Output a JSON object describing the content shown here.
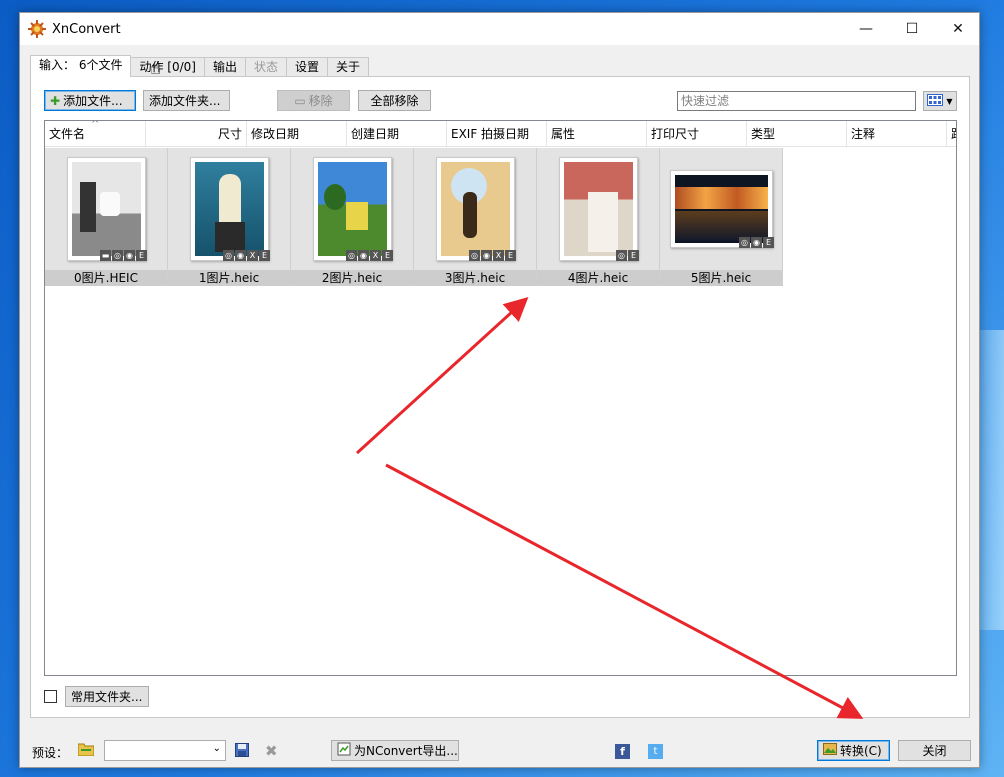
{
  "window": {
    "title": "XnConvert",
    "minimize": "—",
    "maximize": "☐",
    "close": "✕"
  },
  "tabs": [
    {
      "label": "输入： 6个文件",
      "state": "active"
    },
    {
      "label": "动作 [0/0]",
      "state": "normal"
    },
    {
      "label": "输出",
      "state": "normal"
    },
    {
      "label": "状态",
      "state": "disabled"
    },
    {
      "label": "设置",
      "state": "normal"
    },
    {
      "label": "关于",
      "state": "normal"
    }
  ],
  "toolbar": {
    "add_files": "添加文件...",
    "add_folder": "添加文件夹...",
    "remove": "移除",
    "remove_all": "全部移除",
    "filter_placeholder": "快速过滤"
  },
  "columns": [
    "文件名",
    "尺寸",
    "修改日期",
    "创建日期",
    "EXIF 拍摄日期",
    "属性",
    "打印尺寸",
    "类型",
    "注释",
    "跟"
  ],
  "files": [
    {
      "name": "0图片.HEIC",
      "badges": [
        "▬",
        "◎",
        "◉",
        "E"
      ],
      "orientation": "portrait"
    },
    {
      "name": "1图片.heic",
      "badges": [
        "◎",
        "◉",
        "X",
        "E"
      ],
      "orientation": "portrait"
    },
    {
      "name": "2图片.heic",
      "badges": [
        "◎",
        "◉",
        "X",
        "E"
      ],
      "orientation": "portrait"
    },
    {
      "name": "3图片.heic",
      "badges": [
        "◎",
        "◉",
        "X",
        "E"
      ],
      "orientation": "portrait"
    },
    {
      "name": "4图片.heic",
      "badges": [
        "◎",
        "E"
      ],
      "orientation": "portrait"
    },
    {
      "name": "5图片.heic",
      "badges": [
        "◎",
        "◉",
        "E"
      ],
      "orientation": "landscape"
    }
  ],
  "favorites_label": "常用文件夹...",
  "bottom": {
    "preset_label": "预设：",
    "export_label": "为NConvert导出...",
    "convert_label": "转换(C)",
    "close_label": "关闭"
  },
  "colors": {
    "annotation_arrow": "#e8262b",
    "selected_tab": "#ffffff",
    "accent": "#0078d7"
  }
}
